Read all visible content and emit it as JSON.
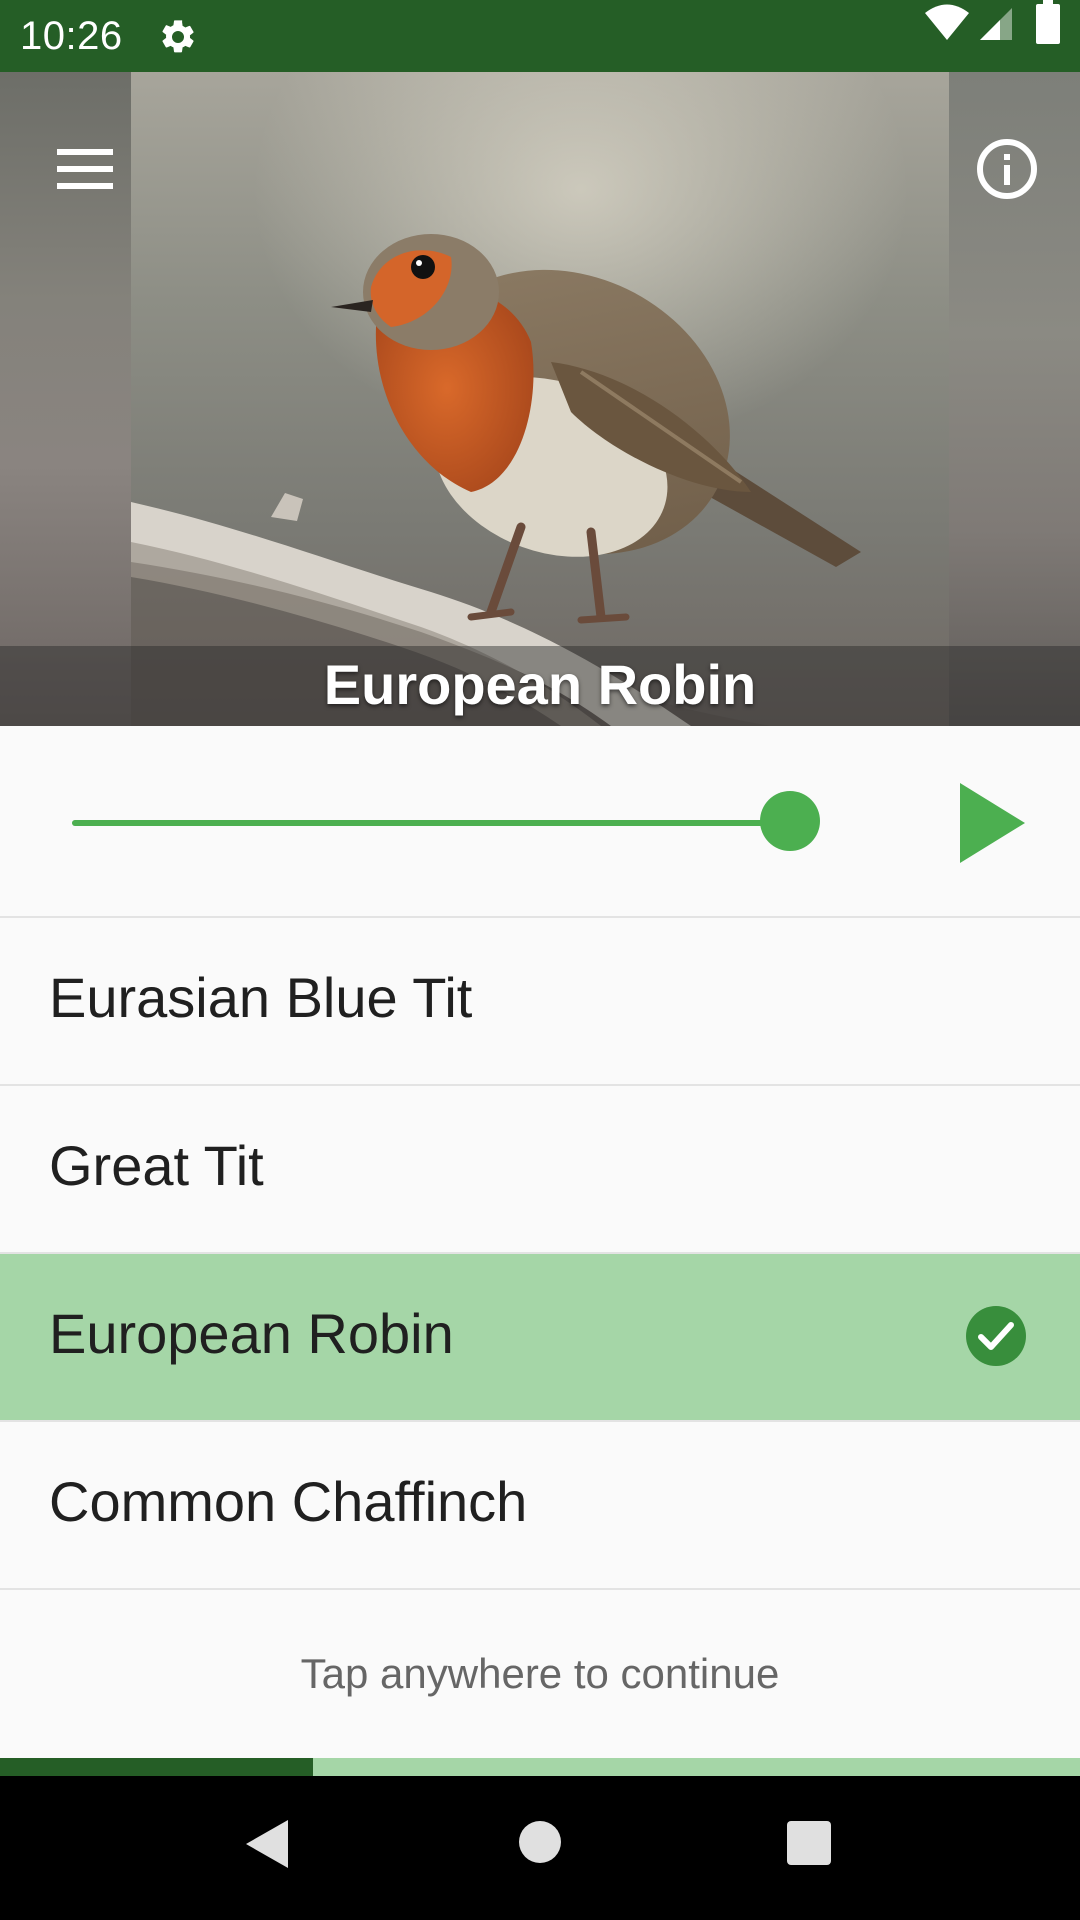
{
  "status_bar": {
    "time": "10:26",
    "icons": [
      "settings-gear-icon",
      "wifi-icon",
      "cell-signal-icon",
      "battery-icon"
    ],
    "background": "#255e26"
  },
  "hero": {
    "image": "european-robin-photo",
    "caption": "European Robin"
  },
  "toolbar": {
    "menu_icon": "hamburger-menu-icon",
    "info_icon": "info-icon"
  },
  "player": {
    "progress": 1.0,
    "play_icon": "play-icon",
    "accent": "#4caf50"
  },
  "answers": [
    {
      "label": "Eurasian Blue Tit",
      "correct": false
    },
    {
      "label": "Great Tit",
      "correct": false
    },
    {
      "label": "European Robin",
      "correct": true
    },
    {
      "label": "Common Chaffinch",
      "correct": false
    }
  ],
  "hint": "Tap anywhere to continue",
  "quiz_progress": {
    "fraction": 0.29,
    "fill_color": "#255e26",
    "track_color": "#a5d6a7"
  },
  "colors": {
    "correct_highlight": "#a5d6a7",
    "check_badge": "#388e3c"
  },
  "nav_bar": {
    "icons": [
      "back-icon",
      "home-icon",
      "recents-icon"
    ]
  }
}
